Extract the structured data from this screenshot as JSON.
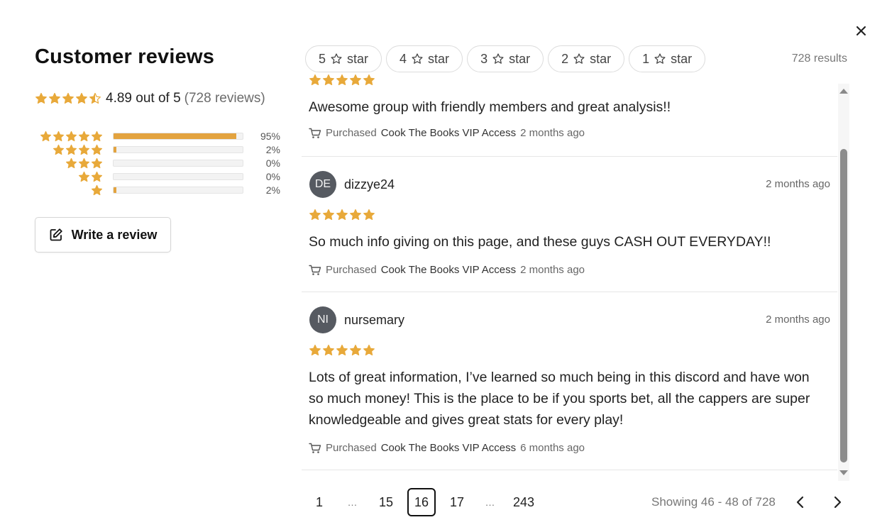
{
  "title": "Customer reviews",
  "summary": {
    "average_text": "4.89 out of 5",
    "count_text": "(728 reviews)",
    "average_rating": 4.89
  },
  "distribution": [
    {
      "stars": 5,
      "fraction": 0.95,
      "percent_label": "95%"
    },
    {
      "stars": 4,
      "fraction": 0.02,
      "percent_label": "2%"
    },
    {
      "stars": 3,
      "fraction": 0.0,
      "percent_label": "0%"
    },
    {
      "stars": 2,
      "fraction": 0.0,
      "percent_label": "0%"
    },
    {
      "stars": 1,
      "fraction": 0.02,
      "percent_label": "2%"
    }
  ],
  "write_review_label": "Write a review",
  "filters": [
    {
      "num": "5",
      "label": "star"
    },
    {
      "num": "4",
      "label": "star"
    },
    {
      "num": "3",
      "label": "star"
    },
    {
      "num": "2",
      "label": "star"
    },
    {
      "num": "1",
      "label": "star"
    }
  ],
  "results_text": "728 results",
  "reviews": [
    {
      "text": "Awesome group with friendly members and great analysis!!",
      "purchased_prefix": "Purchased",
      "product": "Cook The Books VIP Access",
      "purchase_age": "2 months ago"
    },
    {
      "initials": "DE",
      "username": "dizzye24",
      "date": "2 months ago",
      "rating": 5,
      "text": "So much info giving on this page, and these guys CASH OUT EVERYDAY!!",
      "purchased_prefix": "Purchased",
      "product": "Cook The Books VIP Access",
      "purchase_age": "2 months ago"
    },
    {
      "initials": "NI",
      "username": "nursemary",
      "date": "2 months ago",
      "rating": 5,
      "text": "Lots of great information, I’ve learned so much being in this discord and have won so much money! This is the place to be if you sports bet, all the cappers are super knowledgeable and gives great stats for every play!",
      "purchased_prefix": "Purchased",
      "product": "Cook The Books VIP Access",
      "purchase_age": "6 months ago"
    }
  ],
  "pagination": {
    "pages": [
      "1",
      "…",
      "15",
      "16",
      "17",
      "…",
      "243"
    ],
    "current": "16",
    "showing_text": "Showing 46 - 48 of 728"
  },
  "colors": {
    "star": "#e8a93a",
    "bar_fill": "#e3a33f",
    "avatar_bg": "#565a61"
  },
  "icons": {
    "close": "close-icon",
    "write": "edit-icon",
    "cart": "cart-icon",
    "prev": "chevron-left-icon",
    "next": "chevron-right-icon"
  }
}
